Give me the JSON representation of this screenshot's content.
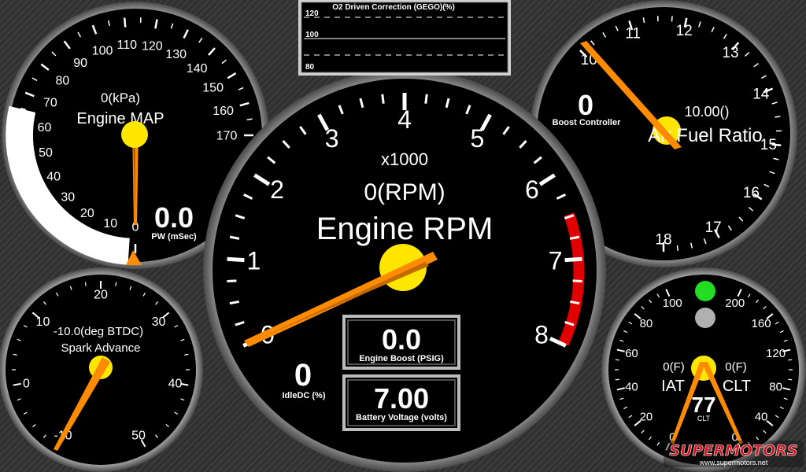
{
  "colors": {
    "needle": "#ff8c00",
    "hub": "#ffe600",
    "redline": "#e00000",
    "indicator_on": "#22dd22",
    "indicator_off": "#b0b0b0",
    "watermark_red": "#d0141c",
    "watermark_blue": "#1a4fa0"
  },
  "icons": {
    "map_marker": "triangle-marker-icon",
    "indicator_green": "status-light-green-icon",
    "indicator_grey": "status-light-grey-icon"
  },
  "o2_chart": {
    "title": "O2 Driven Correction (GEGO)(%)",
    "ticks": [
      "120",
      "100",
      "80"
    ]
  },
  "map_gauge": {
    "ticks": [
      "0",
      "10",
      "20",
      "30",
      "40",
      "50",
      "60",
      "70",
      "80",
      "90",
      "100",
      "110",
      "120",
      "130",
      "140",
      "150",
      "160",
      "170"
    ],
    "value_unit": "0(kPa)",
    "title": "Engine MAP",
    "pw_value": "0.0",
    "pw_label": "PW (mSec)"
  },
  "rpm_gauge": {
    "ticks": [
      "0",
      "1",
      "2",
      "3",
      "4",
      "5",
      "6",
      "7",
      "8"
    ],
    "multiplier": "x1000",
    "value_unit": "0(RPM)",
    "title": "Engine RPM",
    "idle_value": "0",
    "idle_label": "IdleDC (%)",
    "boost_value": "0.0",
    "boost_label": "Engine Boost (PSIG)",
    "battery_value": "7.00",
    "battery_label": "Battery Voltage (volts)"
  },
  "afr_gauge": {
    "ticks": [
      "10",
      "11",
      "12",
      "13",
      "14",
      "15",
      "16",
      "17",
      "18"
    ],
    "boost_ctrl_value": "0",
    "boost_ctrl_label": "Boost Controller",
    "value_unit": "10.00()",
    "title": "Air Fuel Ratio"
  },
  "spark_gauge": {
    "ticks": [
      "-10",
      "0",
      "10",
      "20",
      "30",
      "40",
      "50"
    ],
    "value_unit": "-10.0(deg BTDC)",
    "title": "Spark Advance"
  },
  "temp_gauge": {
    "left_ticks": [
      "0",
      "20",
      "40",
      "60",
      "80",
      "100"
    ],
    "right_ticks": [
      "0",
      "40",
      "80",
      "120",
      "160",
      "200"
    ],
    "iat_value_unit": "0(F)",
    "iat_title": "IAT",
    "clt_value_unit": "0(F)",
    "clt_title": "CLT",
    "clt_value": "77",
    "clt_small": "CLT"
  },
  "watermark": {
    "brand": "SUPERMOTORS",
    "url": "www.supermotors.net"
  }
}
